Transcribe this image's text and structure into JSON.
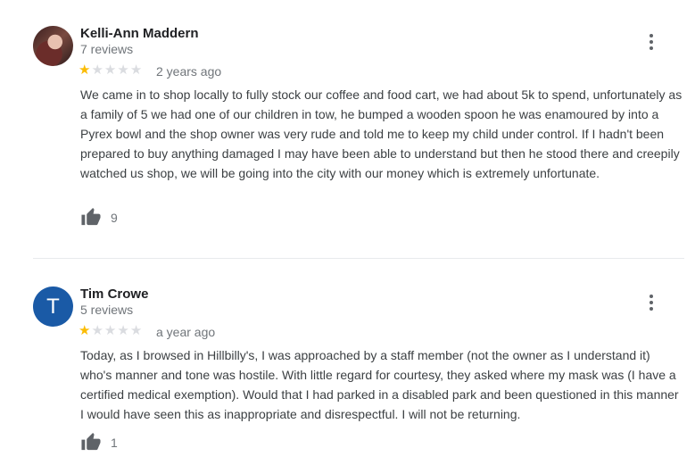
{
  "reviews": [
    {
      "author": "Kelli-Ann Maddern",
      "review_count": "7 reviews",
      "rating": 1,
      "rating_max": 5,
      "date": "2 years ago",
      "text": "We came in to shop locally to fully stock our coffee and food cart, we had about 5k to spend, unfortunately as a family of 5 we had one of our children in tow, he bumped a wooden spoon he was enamoured by into a Pyrex bowl and the shop owner was very rude and told me to keep my child under control. If I hadn't been prepared to buy anything damaged I may have been able to understand but then he stood there and creepily watched us shop, we will be going into the city with our money which is extremely unfortunate.",
      "likes": "9"
    },
    {
      "author": "Tim Crowe",
      "avatar_letter": "T",
      "review_count": "5 reviews",
      "rating": 1,
      "rating_max": 5,
      "date": "a year ago",
      "text": "Today, as I browsed in Hillbilly's, I was approached by a staff member (not the owner as I understand it) who's manner and tone was hostile. With little regard for courtesy, they asked where my mask was (I have a certified medical exemption). Would that I had parked in a disabled park and been questioned in this manner I would have seen this as inappropriate and disrespectful. I will not be returning.",
      "likes": "1"
    }
  ],
  "colors": {
    "star_filled": "#fbbc04",
    "star_empty": "#dadce0",
    "avatar_blue": "#1a5aa6"
  },
  "icons": {
    "menu": "more-vert-icon",
    "like": "thumb-up-icon",
    "star": "star-icon"
  }
}
